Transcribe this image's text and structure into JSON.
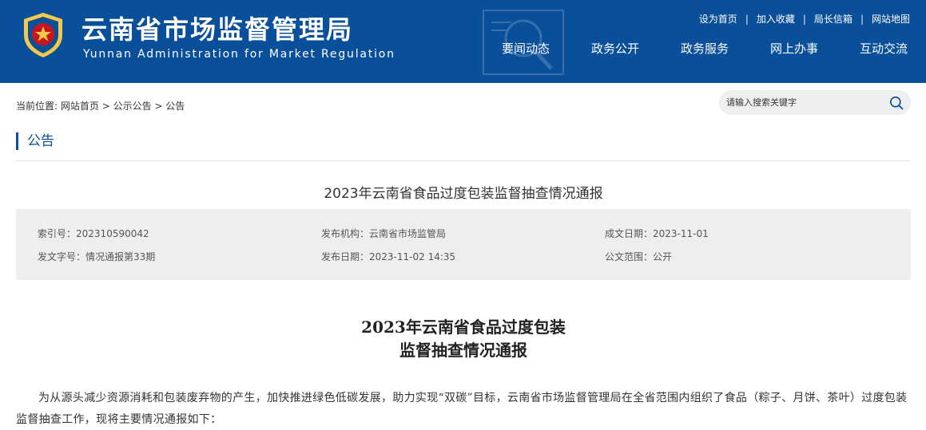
{
  "header": {
    "site_title": "云南省市场监督管理局",
    "site_subtitle": "Yunnan Administration for Market Regulation",
    "top_links": [
      "设为首页",
      "加入收藏",
      "局长信箱",
      "网站地图"
    ],
    "top_link_separator": "|",
    "nav": [
      "要闻动态",
      "政务公开",
      "政务服务",
      "网上办事",
      "互动交流"
    ],
    "colors": {
      "brand_blue": "#0a4f9a",
      "emblem_red": "#c8161d",
      "emblem_gold": "#f2c94c"
    }
  },
  "breadcrumb": {
    "prefix": "当前位置:",
    "items": [
      "网站首页",
      "公示公告",
      "公告"
    ],
    "separator": ">"
  },
  "search": {
    "placeholder": "请输入搜索关键字",
    "icon": "search-icon"
  },
  "section": {
    "title": "公告"
  },
  "article_head": {
    "title": "2023年云南省食品过度包装监督抽查情况通报"
  },
  "meta": {
    "index_no": {
      "label": "索引号：",
      "value": "202310590042"
    },
    "publisher": {
      "label": "发布机构：",
      "value": "云南省市场监管局"
    },
    "created_date": {
      "label": "成文日期：",
      "value": "2023-11-01"
    },
    "doc_no": {
      "label": "发文字号：",
      "value": "情况通报第33期"
    },
    "publish_date": {
      "label": "发布日期：",
      "value": "2023-11-02 14:35"
    },
    "scope": {
      "label": "公文范围：",
      "value": "公开"
    }
  },
  "article": {
    "title_line1": "2023年云南省食品过度包装",
    "title_line2": "监督抽查情况通报",
    "body": "为从源头减少资源消耗和包装废弃物的产生，加快推进绿色低碳发展，助力实现“双碳”目标，云南省市场监督管理局在全省范围内组织了食品（粽子、月饼、茶叶）过度包装监督抽查工作，现将主要情况通报如下："
  }
}
